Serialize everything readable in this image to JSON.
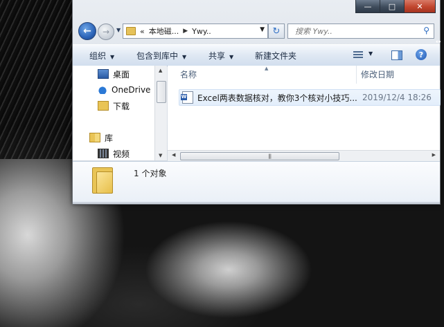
{
  "window": {
    "caption_buttons": {
      "minimize": "—",
      "maximize": "□",
      "close": "✕"
    }
  },
  "navigation": {
    "back_symbol": "←",
    "forward_symbol": "→",
    "address": {
      "breadcrumbs": [
        "«",
        "本地磁...",
        "Ywy.."
      ],
      "separator": "▶"
    },
    "refresh_symbol": "↻",
    "search": {
      "placeholder": "搜索 Ywy.."
    }
  },
  "toolbar": {
    "organize": "组织",
    "include_in_library": "包含到库中",
    "share": "共享",
    "new_folder": "新建文件夹"
  },
  "nav_pane": {
    "items": [
      {
        "label": "桌面",
        "icon": "desktop-icon"
      },
      {
        "label": "OneDrive",
        "icon": "onedrive-cloud-icon"
      },
      {
        "label": "下载",
        "icon": "downloads-folder-icon"
      },
      {
        "label": "库",
        "icon": "libraries-icon"
      },
      {
        "label": "视频",
        "icon": "videos-icon"
      }
    ]
  },
  "file_list": {
    "columns": [
      "名称",
      "修改日期"
    ],
    "rows": [
      {
        "name": "Excel两表数据核对，教你3个核对小技巧...",
        "modified": "2019/12/4 18:26",
        "icon": "word-document-icon"
      }
    ]
  },
  "details_pane": {
    "object_count": "1 个对象"
  },
  "colors": {
    "accent_blue": "#2c64b8",
    "folder_yellow": "#e9c456",
    "toolbar_text": "#1e2d44"
  }
}
